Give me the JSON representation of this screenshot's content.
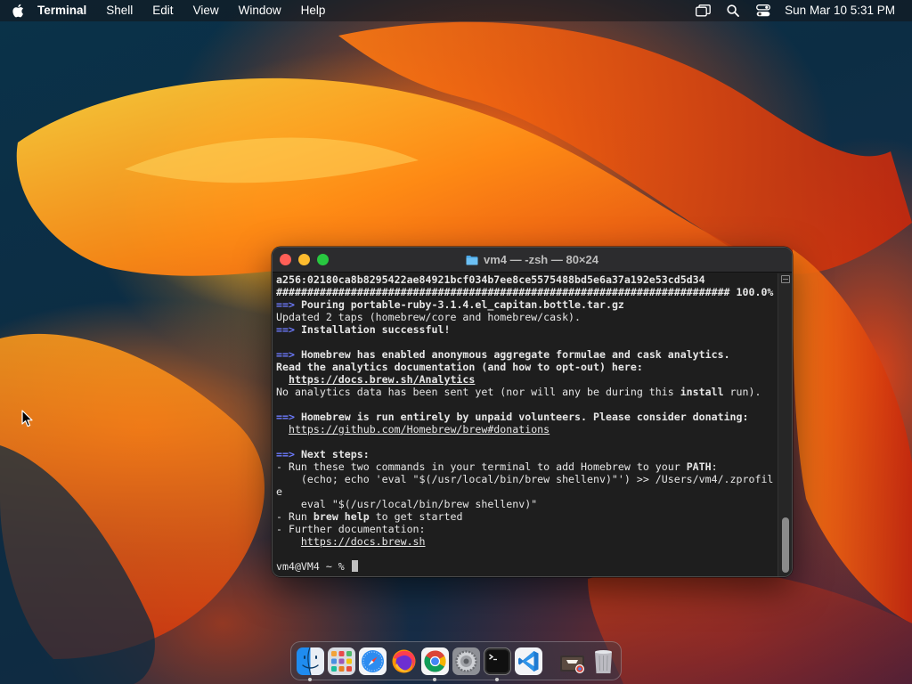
{
  "menubar": {
    "apple_icon": "apple-logo-icon",
    "app_name": "Terminal",
    "menus": [
      "Shell",
      "Edit",
      "View",
      "Window",
      "Help"
    ],
    "status_icons": [
      "screen-mirroring-icon",
      "spotlight-search-icon",
      "control-center-icon"
    ],
    "clock": "Sun Mar 10  5:31 PM"
  },
  "terminal": {
    "title": "vm4 — -zsh — 80×24",
    "title_icon": "folder-icon",
    "lines": [
      [
        {
          "t": "a256:02180ca8b8295422ae84921bcf034b7ee8ce5575488bd5e6a37a192e53cd5d34",
          "c": "b"
        }
      ],
      [
        {
          "t": "######################################################################### 100.0%",
          "c": "b"
        }
      ],
      [
        {
          "t": "==>",
          "c": "arrow"
        },
        {
          "t": " ",
          "c": ""
        },
        {
          "t": "Pouring portable-ruby-3.1.4.el_capitan.bottle.tar.gz",
          "c": "b"
        }
      ],
      [
        {
          "t": "Updated 2 taps (homebrew/core and homebrew/cask).",
          "c": ""
        }
      ],
      [
        {
          "t": "==>",
          "c": "arrow"
        },
        {
          "t": " ",
          "c": ""
        },
        {
          "t": "Installation successful!",
          "c": "b"
        }
      ],
      [],
      [
        {
          "t": "==>",
          "c": "arrow"
        },
        {
          "t": " ",
          "c": ""
        },
        {
          "t": "Homebrew has enabled anonymous aggregate formulae and cask analytics.",
          "c": "b"
        }
      ],
      [
        {
          "t": "Read the analytics documentation (and how to opt-out) here:",
          "c": "b"
        }
      ],
      [
        {
          "t": "  ",
          "c": ""
        },
        {
          "t": "https://docs.brew.sh/Analytics",
          "c": "b link"
        }
      ],
      [
        {
          "t": "No analytics data has been sent yet (nor will any be during this ",
          "c": ""
        },
        {
          "t": "install",
          "c": "b"
        },
        {
          "t": " run).",
          "c": ""
        }
      ],
      [],
      [
        {
          "t": "==>",
          "c": "arrow"
        },
        {
          "t": " ",
          "c": ""
        },
        {
          "t": "Homebrew is run entirely by unpaid volunteers. Please consider donating:",
          "c": "b"
        }
      ],
      [
        {
          "t": "  ",
          "c": ""
        },
        {
          "t": "https://github.com/Homebrew/brew#donations",
          "c": "link"
        }
      ],
      [],
      [
        {
          "t": "==>",
          "c": "arrow"
        },
        {
          "t": " ",
          "c": ""
        },
        {
          "t": "Next steps:",
          "c": "b"
        }
      ],
      [
        {
          "t": "- Run these two commands in your terminal to add Homebrew to your ",
          "c": ""
        },
        {
          "t": "PATH",
          "c": "b"
        },
        {
          "t": ":",
          "c": ""
        }
      ],
      [
        {
          "t": "    (echo; echo 'eval \"$(/usr/local/bin/brew shellenv)\"') >> /Users/vm4/.zprofil",
          "c": ""
        }
      ],
      [
        {
          "t": "e",
          "c": ""
        }
      ],
      [
        {
          "t": "    eval \"$(/usr/local/bin/brew shellenv)\"",
          "c": ""
        }
      ],
      [
        {
          "t": "- Run ",
          "c": ""
        },
        {
          "t": "brew help",
          "c": "b"
        },
        {
          "t": " to get started",
          "c": ""
        }
      ],
      [
        {
          "t": "- Further documentation:",
          "c": ""
        }
      ],
      [
        {
          "t": "    ",
          "c": ""
        },
        {
          "t": "https://docs.brew.sh",
          "c": "link"
        }
      ],
      [],
      [
        {
          "t": "vm4@VM4 ~ % ",
          "c": ""
        }
      ]
    ],
    "scroll_position": 1.0
  },
  "dock": {
    "apps": [
      {
        "name": "Finder",
        "icon": "finder-icon",
        "running": true
      },
      {
        "name": "Launchpad",
        "icon": "launchpad-icon",
        "running": false
      },
      {
        "name": "Safari",
        "icon": "safari-icon",
        "running": false
      },
      {
        "name": "Firefox",
        "icon": "firefox-icon",
        "running": false
      },
      {
        "name": "Google Chrome",
        "icon": "chrome-icon",
        "running": true
      },
      {
        "name": "System Settings",
        "icon": "system-settings-icon",
        "running": false
      },
      {
        "name": "Terminal",
        "icon": "terminal-icon",
        "running": true
      },
      {
        "name": "Visual Studio Code",
        "icon": "vscode-icon",
        "running": false
      }
    ],
    "others": [
      {
        "name": "Downloads",
        "icon": "downloads-stack-icon"
      },
      {
        "name": "Trash",
        "icon": "trash-icon"
      }
    ]
  },
  "colors": {
    "terminal_bg": "#1e1e1e",
    "prompt_arrow": "#6d7bff",
    "close": "#ff5f57",
    "minimize": "#febc2e",
    "zoom": "#28c840"
  }
}
